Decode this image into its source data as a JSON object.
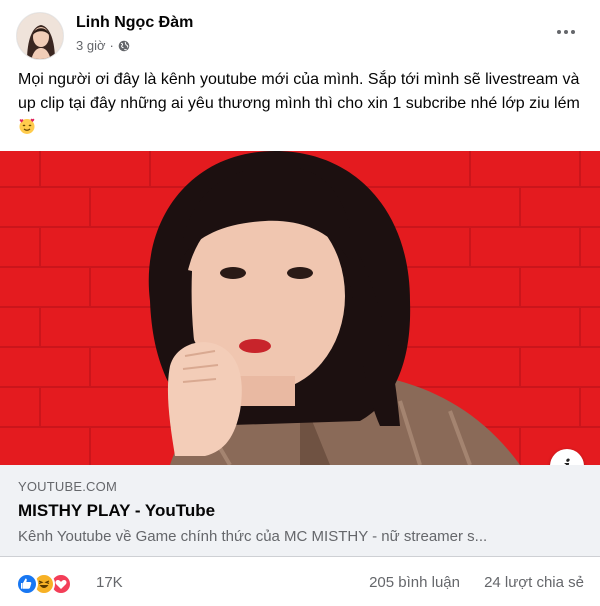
{
  "post": {
    "author": "Linh Ngọc Đàm",
    "time": "3 giờ",
    "separator": "·",
    "text": "Mọi người ơi đây là kênh youtube mới của mình. Sắp tới mình sẽ livestream và up clip tại đây những ai yêu thương mình thì cho xin 1 subcribe nhé lớp ziu lém",
    "emoji_icon": "smiling-face-with-hearts-icon"
  },
  "link_preview": {
    "domain": "YOUTUBE.COM",
    "title": "MISTHY PLAY - YouTube",
    "description": "Kênh Youtube về Game chính thức của MC MISTHY - nữ streamer s..."
  },
  "footer": {
    "reaction_icons": [
      "like-icon",
      "haha-icon",
      "love-icon"
    ],
    "reaction_count": "17K",
    "comments": "205 bình luận",
    "shares": "24 lượt chia sẻ"
  },
  "colors": {
    "background": "#ffffff",
    "secondary_text": "#65676b",
    "link_box": "#f0f2f5",
    "like_blue": "#1877f2",
    "haha_yellow": "#f7b125",
    "love_red": "#f33e58",
    "image_red": "#e01d1d"
  }
}
